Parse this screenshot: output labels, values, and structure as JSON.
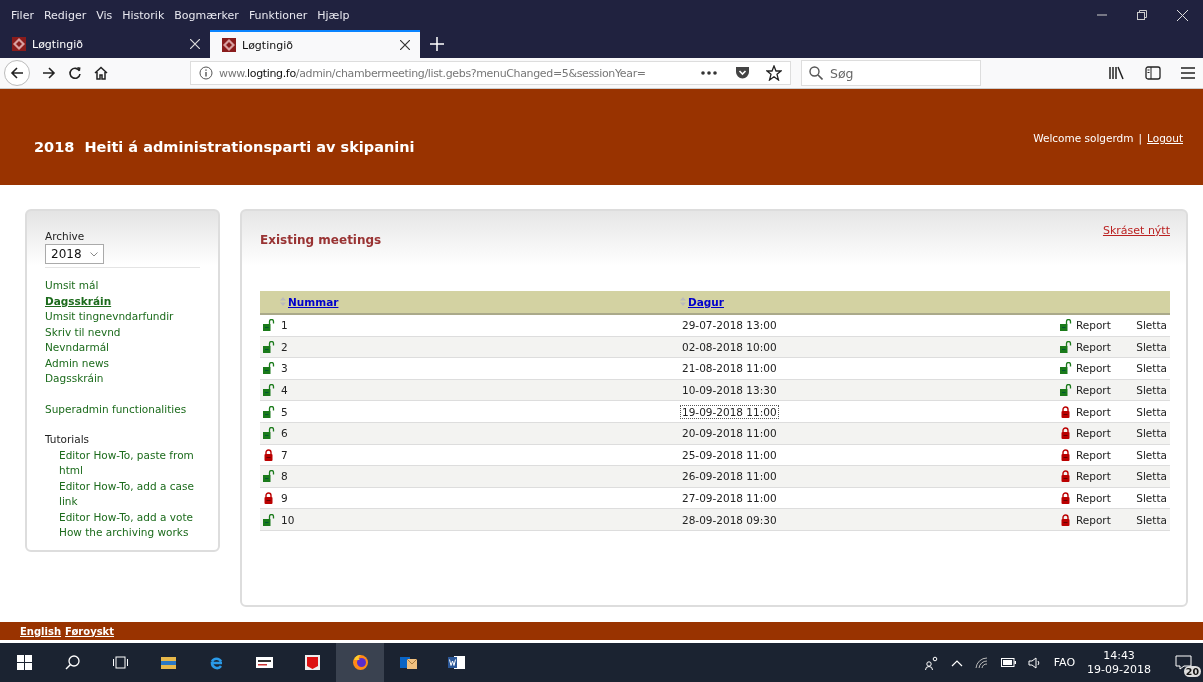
{
  "browser": {
    "menu": [
      "Filer",
      "Rediger",
      "Vis",
      "Historik",
      "Bogmærker",
      "Funktioner",
      "Hjælp"
    ],
    "tabs": [
      {
        "title": "Løgtingið",
        "selected": false
      },
      {
        "title": "Løgtingið",
        "selected": true
      }
    ],
    "url": {
      "prefix": "www.",
      "domain": "logting.fo",
      "path": "/admin/chambermeeting/list.gebs?menuChanged=5&sessionYear="
    },
    "search": {
      "placeholder": "Søg"
    }
  },
  "header": {
    "title": "2018  Heiti á administrationsparti av skipanini",
    "welcome": "Welcome solgerdm",
    "separator": "|",
    "logout": "Logout"
  },
  "sidebar": {
    "archive_label": "Archive",
    "year": "2018",
    "nav": [
      {
        "label": "Umsit mál",
        "selected": false
      },
      {
        "label": "Dagsskráin",
        "selected": true
      },
      {
        "label": "Umsit tingnevndarfundir",
        "selected": false
      },
      {
        "label": "Skriv til nevnd",
        "selected": false
      },
      {
        "label": "Nevndarmál",
        "selected": false
      },
      {
        "label": "Admin news",
        "selected": false
      },
      {
        "label": "Dagsskráin",
        "selected": false
      }
    ],
    "superadmin": "Superadmin functionalities",
    "tutorials_heading": "Tutorials",
    "tutorials": [
      "Editor How-To, paste from html",
      "Editor How-To, add a case link",
      "Editor How-To, add a vote",
      "How the archiving works"
    ]
  },
  "meetings": {
    "title": "Existing meetings",
    "create_link": "Skráset nýtt",
    "columns": [
      "Nummar",
      "Dagur"
    ],
    "rows": [
      {
        "number": "1",
        "locked": false,
        "date": "29-07-2018 13:00",
        "focused": false,
        "report_locked": false,
        "report": "Report",
        "delete": "Sletta"
      },
      {
        "number": "2",
        "locked": false,
        "date": "02-08-2018 10:00",
        "focused": false,
        "report_locked": false,
        "report": "Report",
        "delete": "Sletta"
      },
      {
        "number": "3",
        "locked": false,
        "date": "21-08-2018 11:00",
        "focused": false,
        "report_locked": false,
        "report": "Report",
        "delete": "Sletta"
      },
      {
        "number": "4",
        "locked": false,
        "date": "10-09-2018 13:30",
        "focused": false,
        "report_locked": false,
        "report": "Report",
        "delete": "Sletta"
      },
      {
        "number": "5",
        "locked": false,
        "date": "19-09-2018 11:00",
        "focused": true,
        "report_locked": true,
        "report": "Report",
        "delete": "Sletta"
      },
      {
        "number": "6",
        "locked": false,
        "date": "20-09-2018 11:00",
        "focused": false,
        "report_locked": true,
        "report": "Report",
        "delete": "Sletta"
      },
      {
        "number": "7",
        "locked": true,
        "date": "25-09-2018 11:00",
        "focused": false,
        "report_locked": true,
        "report": "Report",
        "delete": "Sletta"
      },
      {
        "number": "8",
        "locked": false,
        "date": "26-09-2018 11:00",
        "focused": false,
        "report_locked": true,
        "report": "Report",
        "delete": "Sletta"
      },
      {
        "number": "9",
        "locked": true,
        "date": "27-09-2018 11:00",
        "focused": false,
        "report_locked": true,
        "report": "Report",
        "delete": "Sletta"
      },
      {
        "number": "10",
        "locked": false,
        "date": "28-09-2018 09:30",
        "focused": false,
        "report_locked": true,
        "report": "Report",
        "delete": "Sletta"
      }
    ]
  },
  "footer": {
    "languages": [
      "English",
      "Føroyskt"
    ]
  },
  "taskbar": {
    "language": "FAO",
    "time": "14:43",
    "date": "19-09-2018",
    "notifications": "20"
  }
}
